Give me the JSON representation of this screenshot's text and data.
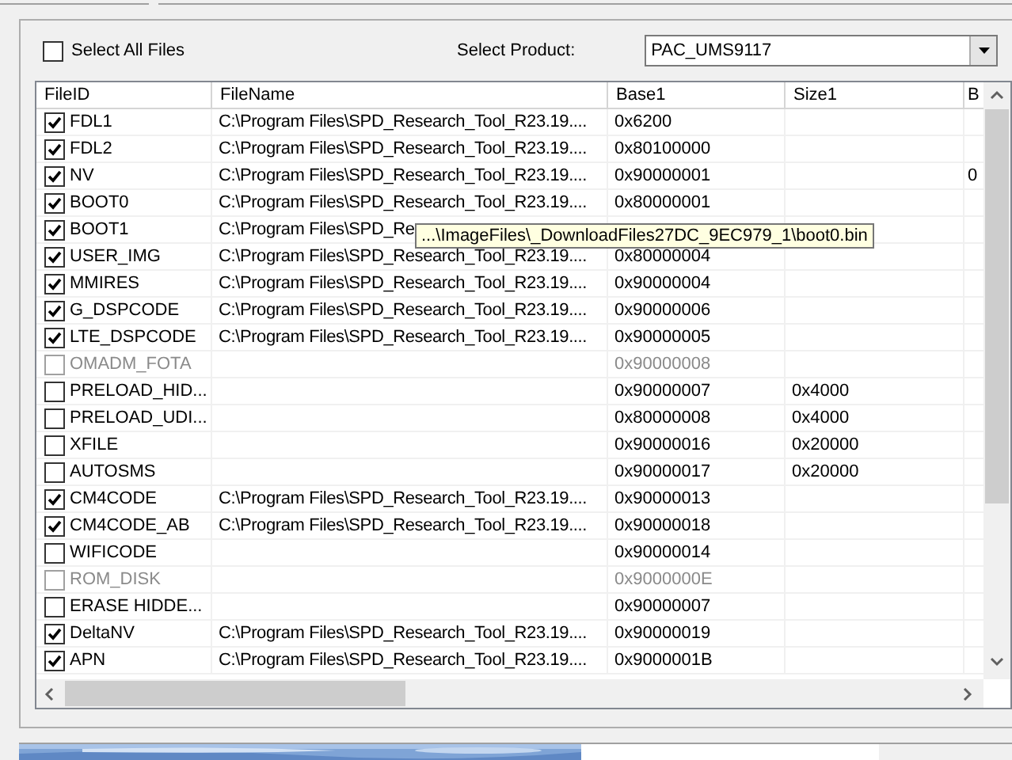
{
  "select_all": {
    "label": "Select All Files",
    "checked": false
  },
  "product": {
    "label": "Select Product:",
    "value": "PAC_UMS9117"
  },
  "table": {
    "columns": [
      "FileID",
      "FileName",
      "Base1",
      "Size1",
      "B"
    ],
    "rows": [
      {
        "checked": true,
        "disabled": false,
        "cells": [
          "FDL1",
          "C:\\Program Files\\SPD_Research_Tool_R23.19....",
          "0x6200",
          "",
          ""
        ]
      },
      {
        "checked": true,
        "disabled": false,
        "cells": [
          "FDL2",
          "C:\\Program Files\\SPD_Research_Tool_R23.19....",
          "0x80100000",
          "",
          ""
        ]
      },
      {
        "checked": true,
        "disabled": false,
        "cells": [
          "NV",
          "C:\\Program Files\\SPD_Research_Tool_R23.19....",
          "0x90000001",
          "",
          "0"
        ]
      },
      {
        "checked": true,
        "disabled": false,
        "cells": [
          "BOOT0",
          "C:\\Program Files\\SPD_Research_Tool_R23.19....",
          "0x80000001",
          "",
          ""
        ]
      },
      {
        "checked": true,
        "disabled": false,
        "cells": [
          "BOOT1",
          "C:\\Program Files\\SPD_Re",
          "",
          "",
          ""
        ]
      },
      {
        "checked": true,
        "disabled": false,
        "cells": [
          "USER_IMG",
          "C:\\Program Files\\SPD_Research_Tool_R23.19....",
          "0x80000004",
          "",
          ""
        ]
      },
      {
        "checked": true,
        "disabled": false,
        "cells": [
          "MMIRES",
          "C:\\Program Files\\SPD_Research_Tool_R23.19....",
          "0x90000004",
          "",
          ""
        ]
      },
      {
        "checked": true,
        "disabled": false,
        "cells": [
          "G_DSPCODE",
          "C:\\Program Files\\SPD_Research_Tool_R23.19....",
          "0x90000006",
          "",
          ""
        ]
      },
      {
        "checked": true,
        "disabled": false,
        "cells": [
          "LTE_DSPCODE",
          "C:\\Program Files\\SPD_Research_Tool_R23.19....",
          "0x90000005",
          "",
          ""
        ]
      },
      {
        "checked": false,
        "disabled": true,
        "cells": [
          "OMADM_FOTA",
          "",
          "0x90000008",
          "",
          ""
        ]
      },
      {
        "checked": false,
        "disabled": false,
        "cells": [
          "PRELOAD_HID...",
          "",
          "0x90000007",
          "0x4000",
          ""
        ]
      },
      {
        "checked": false,
        "disabled": false,
        "cells": [
          "PRELOAD_UDI...",
          "",
          "0x80000008",
          "0x4000",
          ""
        ]
      },
      {
        "checked": false,
        "disabled": false,
        "cells": [
          "XFILE",
          "",
          "0x90000016",
          "0x20000",
          ""
        ]
      },
      {
        "checked": false,
        "disabled": false,
        "cells": [
          "AUTOSMS",
          "",
          "0x90000017",
          "0x20000",
          ""
        ]
      },
      {
        "checked": true,
        "disabled": false,
        "cells": [
          "CM4CODE",
          "C:\\Program Files\\SPD_Research_Tool_R23.19....",
          "0x90000013",
          "",
          ""
        ]
      },
      {
        "checked": true,
        "disabled": false,
        "cells": [
          "CM4CODE_AB",
          "C:\\Program Files\\SPD_Research_Tool_R23.19....",
          "0x90000018",
          "",
          ""
        ]
      },
      {
        "checked": false,
        "disabled": false,
        "cells": [
          "WIFICODE",
          "",
          "0x90000014",
          "",
          ""
        ]
      },
      {
        "checked": false,
        "disabled": true,
        "cells": [
          "ROM_DISK",
          "",
          "0x9000000E",
          "",
          ""
        ]
      },
      {
        "checked": false,
        "disabled": false,
        "cells": [
          "ERASE HIDDE...",
          "",
          "0x90000007",
          "",
          ""
        ]
      },
      {
        "checked": true,
        "disabled": false,
        "cells": [
          "DeltaNV",
          "C:\\Program Files\\SPD_Research_Tool_R23.19....",
          "0x90000019",
          "",
          ""
        ]
      },
      {
        "checked": true,
        "disabled": false,
        "cells": [
          "APN",
          "C:\\Program Files\\SPD_Research_Tool_R23.19....",
          "0x9000001B",
          "",
          ""
        ]
      }
    ]
  },
  "tooltip": "...\\ImageFiles\\_DownloadFiles27DC_9EC979_1\\boot0.bin"
}
